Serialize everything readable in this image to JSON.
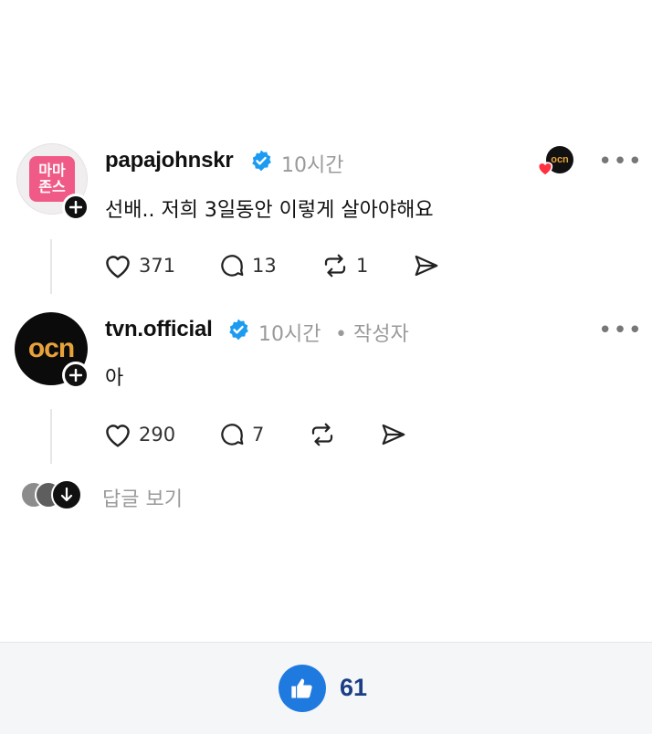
{
  "posts": [
    {
      "username": "papajohnskr",
      "time": "10시간",
      "text": "선배.. 저희 3일동안 이렇게 살아야해요",
      "avatar_text_line1": "마마",
      "avatar_text_line2": "존스",
      "likes": "371",
      "replies": "13",
      "reposts": "1",
      "liked_by_badge": "ocn"
    },
    {
      "username": "tvn.official",
      "time": "10시간",
      "author_tag": "• 작성자",
      "text": "아",
      "avatar_text": "ocn",
      "likes": "290",
      "replies": "7"
    }
  ],
  "view_replies": "답글 보기",
  "footer": {
    "like_count": "61"
  },
  "colors": {
    "verified": "#1d9bf0",
    "like_button": "#1f7ae0",
    "like_count": "#1a3f86"
  }
}
